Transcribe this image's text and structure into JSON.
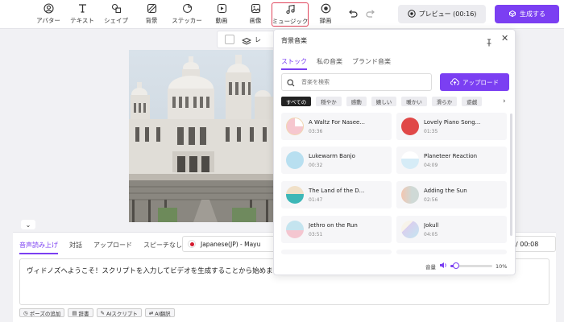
{
  "toolbar": {
    "tools": [
      {
        "label": "アバター",
        "icon": "avatar-icon"
      },
      {
        "label": "テキスト",
        "icon": "text-icon"
      },
      {
        "label": "シェイプ",
        "icon": "shape-icon"
      },
      {
        "label": "背景",
        "icon": "background-icon"
      },
      {
        "label": "ステッカー",
        "icon": "sticker-icon"
      },
      {
        "label": "動画",
        "icon": "video-icon"
      },
      {
        "label": "画像",
        "icon": "image-icon"
      },
      {
        "label": "ミュージック",
        "icon": "music-icon"
      },
      {
        "label": "録画",
        "icon": "record-icon"
      }
    ],
    "preview_label": "プレビュー (00:16)",
    "generate_label": "生成する"
  },
  "canvas": {
    "layer_label": "レ"
  },
  "script": {
    "tabs": [
      "音声読み上げ",
      "対話",
      "アップロード",
      "スピーチなし"
    ],
    "selected_tab": "音声読み上げ",
    "voice": "Japanese(JP) - Mayu",
    "time": "/ 00:08",
    "text": "ヴィドノズへようこそ！スクリプトを入力してビデオを生成することから始めましょう。",
    "actions": [
      "ポーズの追加",
      "辞書",
      "AIスクリプト",
      "AI翻訳"
    ]
  },
  "music": {
    "title": "背景音楽",
    "tabs": [
      "ストック",
      "私の音楽",
      "ブランド音楽"
    ],
    "selected_tab": "ストック",
    "search_placeholder": "音楽を検索",
    "upload_label": "アップロード",
    "filters": [
      "すべての",
      "穏やか",
      "感動",
      "嬉しい",
      "暖かい",
      "滑らか",
      "遊戯"
    ],
    "selected_filter": "すべての",
    "tracks": [
      {
        "name": "A Waltz For Nasee...",
        "duration": "03:36",
        "color": "#f6c7cf"
      },
      {
        "name": "Lovely Piano Song...",
        "duration": "01:35",
        "color": "#e04848"
      },
      {
        "name": "Lukewarm Banjo",
        "duration": "00:32",
        "color": "#b8dff0"
      },
      {
        "name": "Planeteer Reaction",
        "duration": "04:09",
        "color": "#d6ecf7"
      },
      {
        "name": "The Land of the D...",
        "duration": "01:47",
        "color": "#3db7b7"
      },
      {
        "name": "Adding the Sun",
        "duration": "02:56",
        "color": "#cfd9d6"
      },
      {
        "name": "Jethro on the Run",
        "duration": "03:51",
        "color": "#c4e4ef"
      },
      {
        "name": "Jokull",
        "duration": "04:05",
        "color": "#d9d0ef"
      }
    ],
    "volume_label": "音量",
    "volume": 10,
    "volume_text": "10%"
  }
}
